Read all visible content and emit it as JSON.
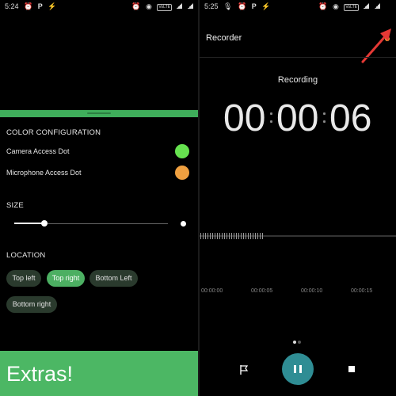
{
  "left": {
    "status": {
      "time": "5:24",
      "volte_label": "VoLTE"
    },
    "section_color": "COLOR CONFIGURATION",
    "camera_label": "Camera Access Dot",
    "camera_color": "#66e24f",
    "mic_label": "Microphone Access Dot",
    "mic_color": "#f0a040",
    "section_size": "SIZE",
    "size_value": 0.2,
    "section_location": "LOCATION",
    "location_options": [
      "Top left",
      "Top right",
      "Bottom Left",
      "Bottom right"
    ],
    "location_selected": "Top right",
    "extras": "Extras!"
  },
  "right": {
    "status": {
      "time": "5:25",
      "volte_label": "VoLTE"
    },
    "app_title": "Recorder",
    "recording_status": "Recording",
    "timer": {
      "h": "00",
      "m": "00",
      "s": "06"
    },
    "timeline": [
      "00:00:00",
      "00:00:05",
      "00:00:10",
      "00:00:15"
    ],
    "indicator_color": "#f0a030",
    "arrow_color": "#e53935",
    "pause_color": "#2f8d94"
  }
}
